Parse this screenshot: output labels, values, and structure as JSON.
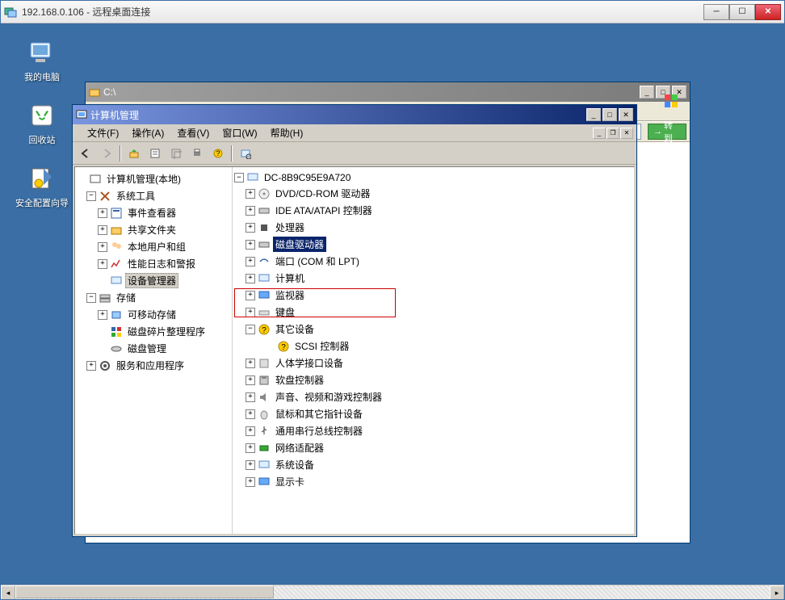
{
  "rdp": {
    "title": "192.168.0.106 - 远程桌面连接",
    "min": "─",
    "max": "☐",
    "close": "✕"
  },
  "desktop": {
    "icons": [
      {
        "label": "我的电脑"
      },
      {
        "label": "回收站"
      },
      {
        "label": "安全配置向导"
      }
    ]
  },
  "explorer": {
    "title": "C:\\",
    "go_label": "转到"
  },
  "mmc": {
    "title": "计算机管理",
    "menu": {
      "file": "文件(F)",
      "action": "操作(A)",
      "view": "查看(V)",
      "window": "窗口(W)",
      "help": "帮助(H)"
    },
    "left_tree": {
      "root": "计算机管理(本地)",
      "system_tools": "系统工具",
      "event_viewer": "事件查看器",
      "shared_folders": "共享文件夹",
      "local_users": "本地用户和组",
      "perf_logs": "性能日志和警报",
      "device_manager": "设备管理器",
      "storage": "存储",
      "removable": "可移动存储",
      "defrag": "磁盘碎片整理程序",
      "disk_mgmt": "磁盘管理",
      "services_apps": "服务和应用程序"
    },
    "right_tree": {
      "computer": "DC-8B9C95E9A720",
      "dvd": "DVD/CD-ROM 驱动器",
      "ide": "IDE ATA/ATAPI 控制器",
      "cpu": "处理器",
      "disk_drive": "磁盘驱动器",
      "ports": "端口 (COM 和 LPT)",
      "computers": "计算机",
      "monitors": "监视器",
      "keyboards": "键盘",
      "other_devices": "其它设备",
      "scsi": "SCSI 控制器",
      "hid": "人体学接口设备",
      "floppy": "软盘控制器",
      "sound": "声音、视频和游戏控制器",
      "mouse": "鼠标和其它指针设备",
      "usb": "通用串行总线控制器",
      "network": "网络适配器",
      "system": "系统设备",
      "display": "显示卡"
    }
  }
}
